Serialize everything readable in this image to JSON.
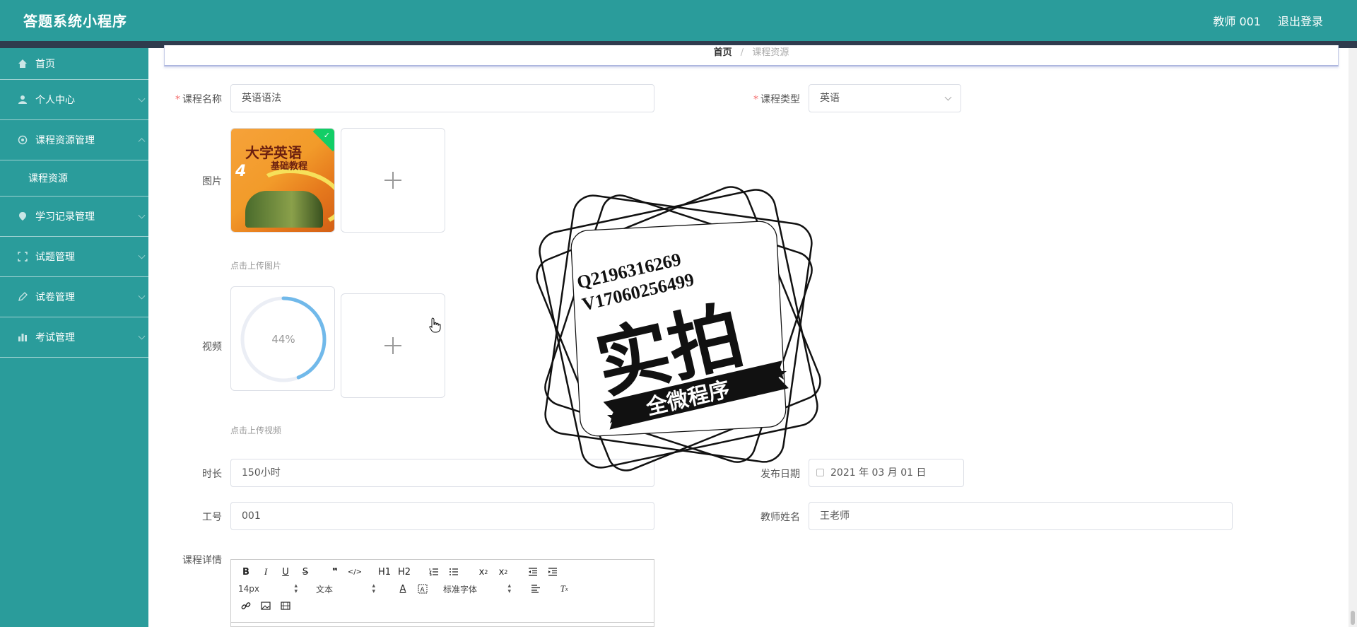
{
  "header": {
    "app_title": "答题系统小程序",
    "user_label": "教师 001",
    "logout_label": "退出登录"
  },
  "sidebar": {
    "items": [
      {
        "label": "首页",
        "icon": "home-icon"
      },
      {
        "label": "个人中心",
        "icon": "user-icon"
      },
      {
        "label": "课程资源管理",
        "icon": "settings-icon",
        "children": [
          {
            "label": "课程资源"
          }
        ]
      },
      {
        "label": "学习记录管理",
        "icon": "location-icon"
      },
      {
        "label": "试题管理",
        "icon": "fullscreen-icon"
      },
      {
        "label": "试卷管理",
        "icon": "pen-icon"
      },
      {
        "label": "考试管理",
        "icon": "chart-icon"
      }
    ]
  },
  "breadcrumb": {
    "home": "首页",
    "separator": "/",
    "current": "课程资源"
  },
  "form": {
    "course_name": {
      "label": "课程名称",
      "value": "英语语法",
      "required": true
    },
    "course_type": {
      "label": "课程类型",
      "value": "英语",
      "required": true
    },
    "image": {
      "label": "图片",
      "hint": "点击上传图片",
      "cover_text": {
        "title": "大学英语",
        "subtitle": "基础教程",
        "number": "4"
      }
    },
    "video": {
      "label": "视频",
      "hint": "点击上传视频",
      "progress": "44%",
      "progress_value": 0.44
    },
    "duration": {
      "label": "时长",
      "value": "150小时"
    },
    "publish_date": {
      "label": "发布日期",
      "value": "2021 年 03 月 01 日"
    },
    "work_id": {
      "label": "工号",
      "value": "001"
    },
    "teacher_name": {
      "label": "教师姓名",
      "value": "王老师"
    },
    "details": {
      "label": "课程详情"
    }
  },
  "editor": {
    "font_size": "14px",
    "text_style": "文本",
    "font_family": "标准字体",
    "buttons": [
      "B",
      "I",
      "U",
      "S",
      "❞",
      "</>",
      "H1",
      "H2"
    ]
  },
  "watermark": {
    "line1": "Q2196316269",
    "line2": "V17060256499",
    "main": "实拍",
    "banner": "全微程序"
  },
  "colors": {
    "primary": "#2a9c9b",
    "dark_strip": "#2f3b4d",
    "required": "#f56c6c",
    "progress": "#71b9ea"
  }
}
